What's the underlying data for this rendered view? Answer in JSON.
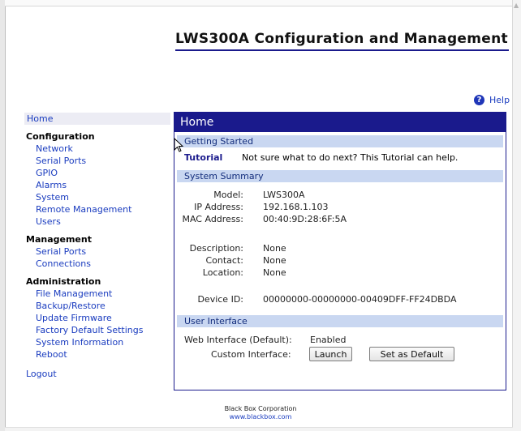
{
  "page_title": "LWS300A Configuration and Management",
  "help": {
    "label": "Help",
    "icon": "help-icon"
  },
  "sidebar": {
    "home": "Home",
    "sections": [
      {
        "heading": "Configuration",
        "items": [
          "Network",
          "Serial Ports",
          "GPIO",
          "Alarms",
          "System",
          "Remote Management",
          "Users"
        ]
      },
      {
        "heading": "Management",
        "items": [
          "Serial Ports",
          "Connections"
        ]
      },
      {
        "heading": "Administration",
        "items": [
          "File Management",
          "Backup/Restore",
          "Update Firmware",
          "Factory Default Settings",
          "System Information",
          "Reboot"
        ]
      }
    ],
    "logout": "Logout"
  },
  "panel": {
    "title": "Home",
    "getting_started": {
      "heading": "Getting Started",
      "tutorial_link": "Tutorial",
      "tutorial_text": "Not sure what to do next? This Tutorial can help."
    },
    "system_summary": {
      "heading": "System Summary",
      "model": {
        "label": "Model:",
        "value": "LWS300A"
      },
      "ip": {
        "label": "IP Address:",
        "value": "192.168.1.103"
      },
      "mac": {
        "label": "MAC Address:",
        "value": "00:40:9D:28:6F:5A"
      },
      "description": {
        "label": "Description:",
        "value": "None"
      },
      "contact": {
        "label": "Contact:",
        "value": "None"
      },
      "location": {
        "label": "Location:",
        "value": "None"
      },
      "device_id": {
        "label": "Device ID:",
        "value": "00000000-00000000-00409DFF-FF24DBDA"
      }
    },
    "user_interface": {
      "heading": "User Interface",
      "web_interface": {
        "label": "Web Interface (Default):",
        "value": "Enabled"
      },
      "custom_interface": {
        "label": "Custom Interface:"
      },
      "launch_button": "Launch",
      "set_default_button": "Set as Default"
    }
  },
  "footer": {
    "company": "Black Box Corporation",
    "url": "www.blackbox.com"
  },
  "colors": {
    "navy": "#1a1a8c",
    "section_bar": "#c9d7f1",
    "link": "#1a3cbf"
  }
}
